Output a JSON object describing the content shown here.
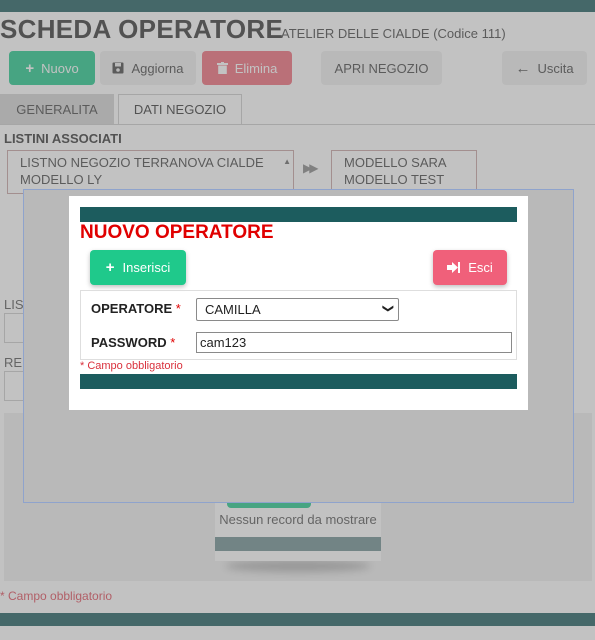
{
  "page": {
    "title": "SCHEDA OPERATORE",
    "subtitle": "ATELIER DELLE CIALDE (Codice 111)",
    "toolbar": {
      "new_label": "Nuovo",
      "update_label": "Aggiorna",
      "delete_label": "Elimina",
      "open_shop_label": "APRI NEGOZIO",
      "exit_label": "Uscita"
    },
    "tabs": [
      {
        "label": "GENERALITA"
      },
      {
        "label": "DATI NEGOZIO"
      }
    ],
    "associated_lists": {
      "label": "LISTINI ASSOCIATI",
      "available": [
        "LISTNO NEGOZIO TERRANOVA CIALDE",
        "MODELLO LY"
      ],
      "selected": [
        "MODELLO SARA",
        "MODELLO TEST"
      ]
    },
    "partial_labels": [
      "LIS",
      "RE"
    ],
    "grid": {
      "empty_message": "Nessun record da mostrare"
    },
    "required_note": "* Campo obbligatorio"
  },
  "modal": {
    "title": "NUOVO OPERATORE",
    "insert_label": "Inserisci",
    "exit_label": "Esci",
    "operator_label": "OPERATORE",
    "operator_value": "CAMILLA",
    "password_label": "PASSWORD",
    "password_value": "cam123",
    "required_star": "*",
    "required_note": "* Campo obbligatorio"
  },
  "colors": {
    "band": "#1c5c5e",
    "success": "#1fc98b",
    "danger": "#f0607a",
    "title_red": "#e00000"
  }
}
